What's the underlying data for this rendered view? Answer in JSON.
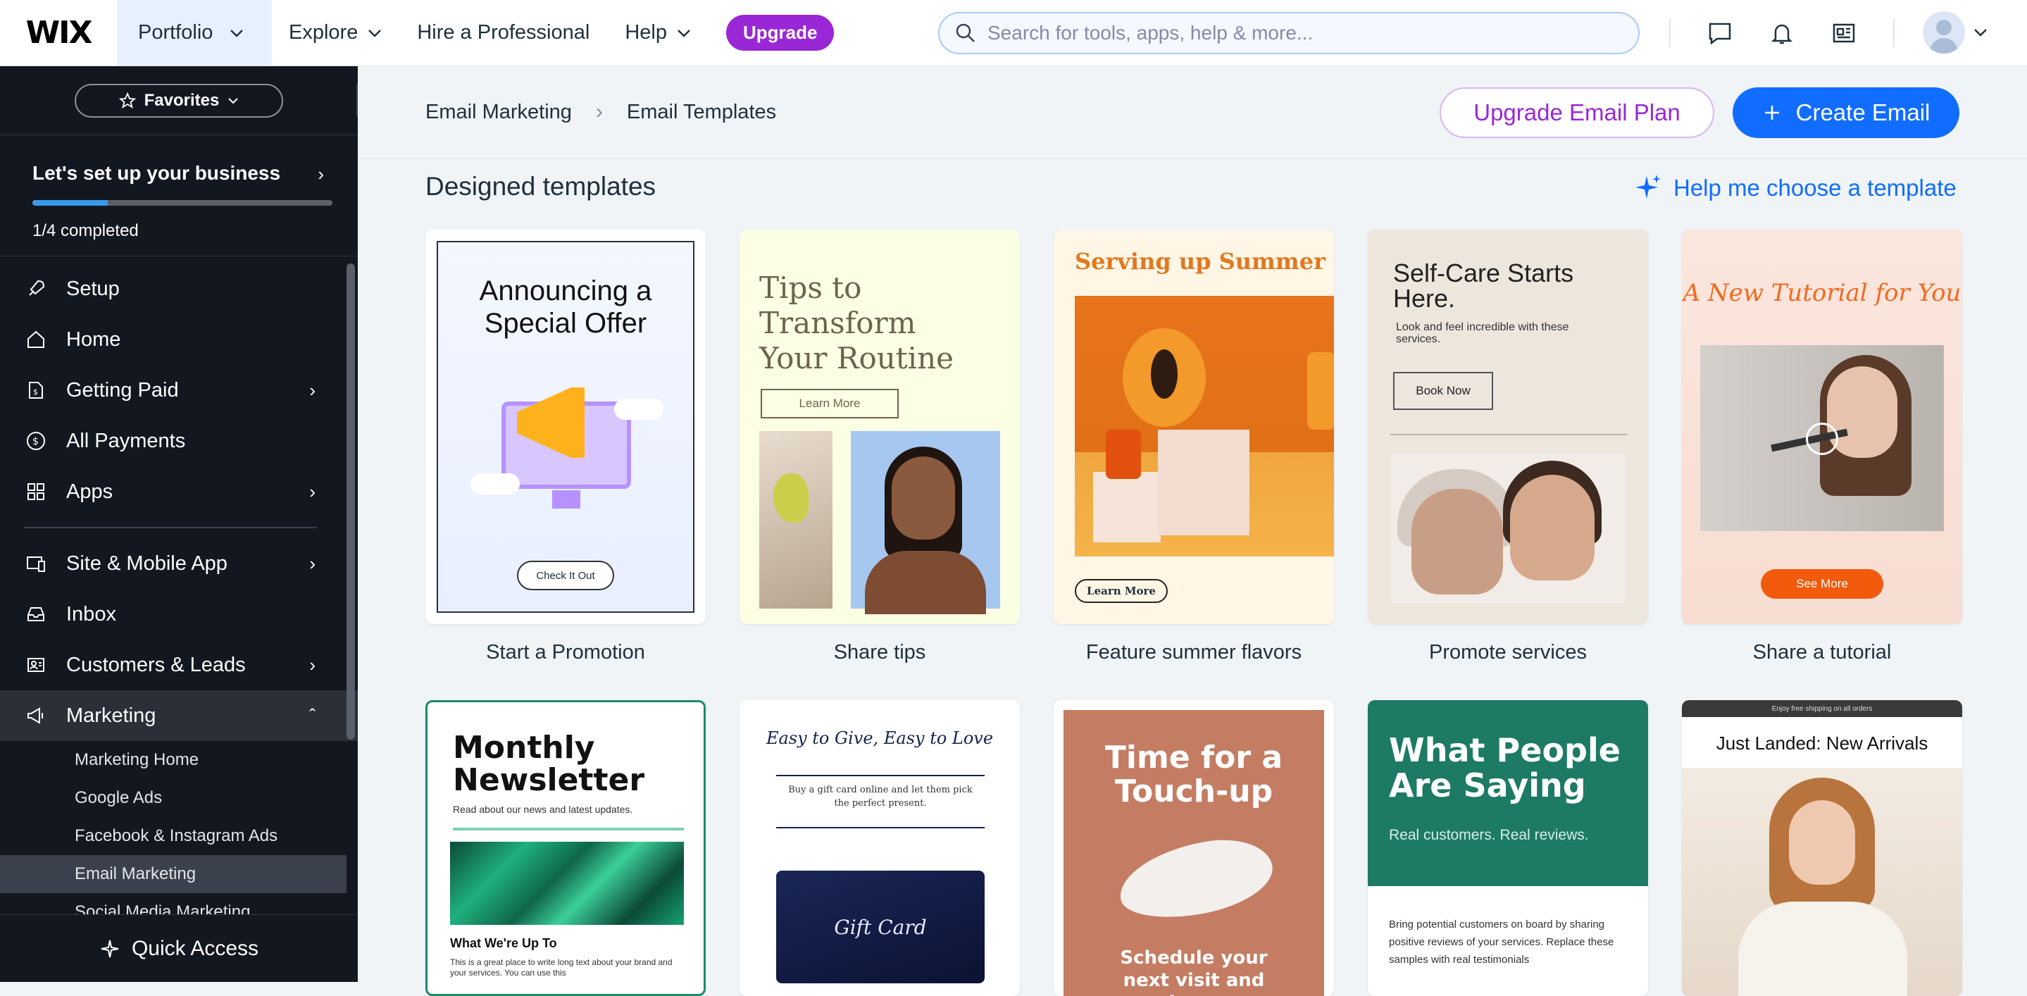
{
  "topbar": {
    "logo": "WIX",
    "site_name": "Portfolio",
    "nav": [
      "Explore",
      "Hire a Professional",
      "Help"
    ],
    "upgrade_label": "Upgrade",
    "search_placeholder": "Search for tools, apps, help & more..."
  },
  "sidebar": {
    "favorites_label": "Favorites",
    "setup_title": "Let's set up your business",
    "setup_progress": 0.25,
    "setup_status": "1/4 completed",
    "items": [
      {
        "label": "Setup",
        "icon": "rocket-icon"
      },
      {
        "label": "Home",
        "icon": "home-icon"
      },
      {
        "label": "Getting Paid",
        "icon": "getting-paid-icon"
      },
      {
        "label": "All Payments",
        "icon": "dollar-icon"
      },
      {
        "label": "Apps",
        "icon": "apps-icon"
      },
      {
        "label": "Site & Mobile App",
        "icon": "site-icon"
      },
      {
        "label": "Inbox",
        "icon": "inbox-icon"
      },
      {
        "label": "Customers & Leads",
        "icon": "customers-icon"
      },
      {
        "label": "Marketing",
        "icon": "megaphone-icon"
      }
    ],
    "marketing_sub": [
      "Marketing Home",
      "Google Ads",
      "Facebook & Instagram Ads",
      "Email Marketing",
      "Social Media Marketing"
    ],
    "quick_access": "Quick Access"
  },
  "header": {
    "breadcrumb": [
      "Email Marketing",
      "Email Templates"
    ],
    "upgrade_plan": "Upgrade Email Plan",
    "create_email": "Create Email"
  },
  "section": {
    "title": "Designed templates",
    "help_link": "Help me choose a template"
  },
  "templates_row1": [
    {
      "label": "Start a Promotion",
      "headline": "Announcing a Special Offer",
      "cta": "Check It Out"
    },
    {
      "label": "Share tips",
      "headline": "Tips to Transform Your Routine",
      "cta": "Learn More"
    },
    {
      "label": "Feature summer flavors",
      "headline": "Serving up Summer",
      "cta": "Learn More"
    },
    {
      "label": "Promote services",
      "headline": "Self-Care Starts Here.",
      "sub": "Look and feel incredible with these services.",
      "cta": "Book Now"
    },
    {
      "label": "Share a tutorial",
      "headline": "A New Tutorial for You",
      "cta": "See More"
    }
  ],
  "templates_row2": [
    {
      "headline": "Monthly Newsletter",
      "sub": "Read about our news and latest updates.",
      "h2": "What We're Up To",
      "body": "This is a great place to write long text about your brand and your services. You can use this"
    },
    {
      "headline": "Easy to Give, Easy to Love",
      "sub": "Buy a gift card online and let them pick the perfect present.",
      "card_text": "Gift Card"
    },
    {
      "headline": "Time for a Touch-up",
      "sub": "Schedule your next visit and keep"
    },
    {
      "headline": "What People Are Saying",
      "sub": "Real customers. Real reviews.",
      "body": "Bring potential customers on board by sharing positive reviews of your services. Replace these samples with real testimonials"
    },
    {
      "bar": "Enjoy free shipping on all orders",
      "headline": "Just Landed: New Arrivals"
    }
  ],
  "colors": {
    "brand_blue": "#116dff",
    "upgrade_purple": "#9a27d5",
    "sidebar_bg": "#131720"
  }
}
